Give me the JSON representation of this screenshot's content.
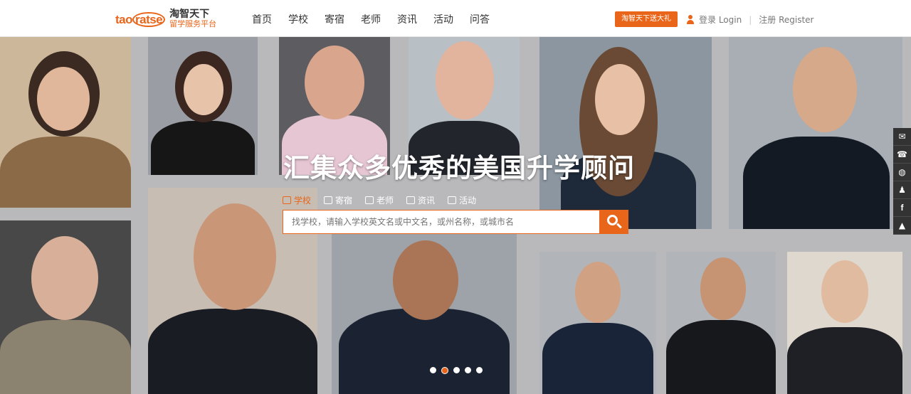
{
  "header": {
    "logo_mark": "taoratse",
    "logo_cn": "淘智天下",
    "logo_sub": "留学服务平台",
    "nav": [
      "首页",
      "学校",
      "寄宿",
      "老师",
      "资讯",
      "活动",
      "问答"
    ],
    "promo": "淘智天下送大礼",
    "login": "登录 Login",
    "separator": "|",
    "register": "注册 Register"
  },
  "hero": {
    "title": "汇集众多优秀的美国升学顾问",
    "tabs": [
      {
        "label": "学校",
        "icon": "school-icon"
      },
      {
        "label": "寄宿",
        "icon": "home-icon"
      },
      {
        "label": "老师",
        "icon": "teacher-icon"
      },
      {
        "label": "资讯",
        "icon": "news-icon"
      },
      {
        "label": "活动",
        "icon": "flag-icon"
      }
    ],
    "search_placeholder": "找学校，请输入学校英文名或中文名，或州名称，或城市名"
  },
  "carousel": {
    "slide_count": 5,
    "active_index": 1
  },
  "side_tools": [
    "mail-icon",
    "phone-icon",
    "wechat-icon",
    "qq-icon",
    "facebook-icon",
    "rocket-icon"
  ],
  "colors": {
    "accent": "#e8651a",
    "header_bg": "#ffffff",
    "mosaic_bg": "#b9b9bb"
  }
}
